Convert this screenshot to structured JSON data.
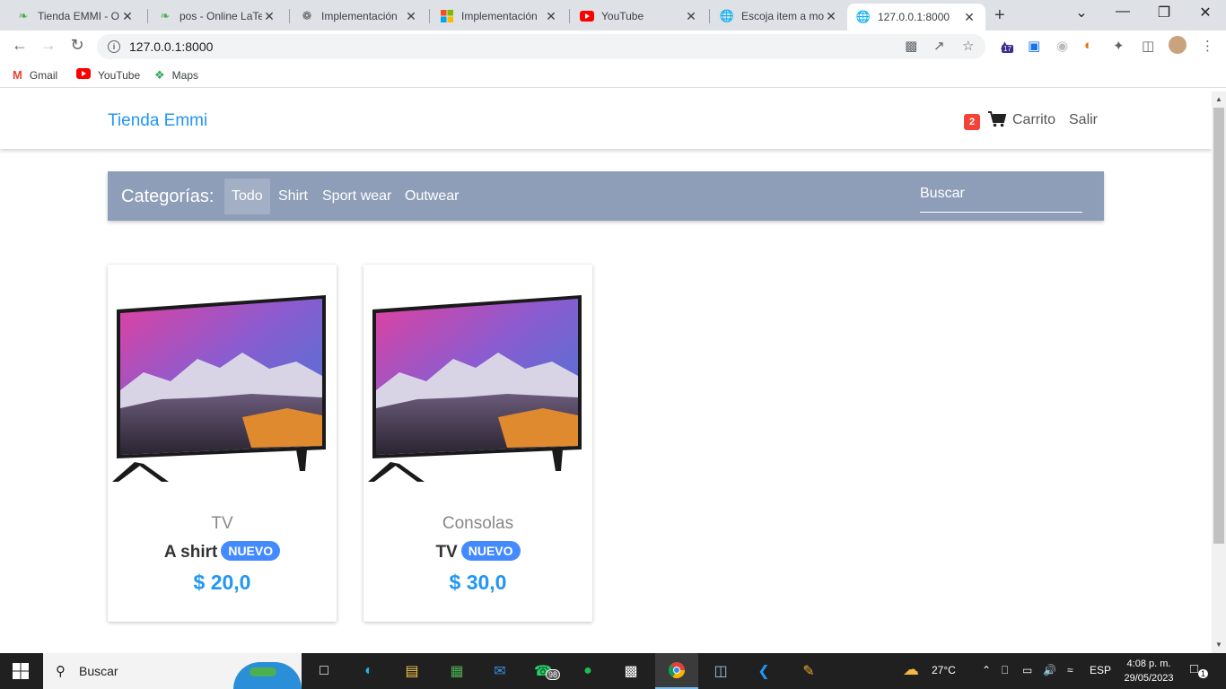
{
  "browser": {
    "tabs": [
      {
        "title": "Tienda EMMI - O",
        "icon": "leaf-icon"
      },
      {
        "title": "pos - Online LaTe",
        "icon": "leaf-icon"
      },
      {
        "title": "Implementación",
        "icon": "openai-icon"
      },
      {
        "title": "Implementación",
        "icon": "microsoft-icon"
      },
      {
        "title": "YouTube",
        "icon": "youtube-icon"
      },
      {
        "title": "Escoja item a mo",
        "icon": "globe-icon"
      },
      {
        "title": "127.0.0.1:8000",
        "icon": "globe-icon",
        "active": true
      }
    ],
    "url": "127.0.0.1:8000",
    "extension_badge": "17",
    "bookmarks": [
      {
        "label": "Gmail",
        "icon": "gmail-icon"
      },
      {
        "label": "YouTube",
        "icon": "youtube-icon"
      },
      {
        "label": "Maps",
        "icon": "maps-icon"
      }
    ]
  },
  "navbar": {
    "brand": "Tienda Emmi",
    "cart_count": "2",
    "cart_label": "Carrito",
    "logout_label": "Salir"
  },
  "categories": {
    "title": "Categorías:",
    "items": [
      "Todo",
      "Shirt",
      "Sport wear",
      "Outwear"
    ],
    "active": "Todo",
    "search_placeholder": "Buscar"
  },
  "products": [
    {
      "category": "TV",
      "name": "A shirt",
      "badge": "NUEVO",
      "price": "$ 20,0"
    },
    {
      "category": "Consolas",
      "name": "TV",
      "badge": "NUEVO",
      "price": "$ 30,0"
    }
  ],
  "taskbar": {
    "search_label": "Buscar",
    "whatsapp_badge": "98",
    "weather": "27°C",
    "language": "ESP",
    "time": "4:08 p. m.",
    "date": "29/05/2023",
    "notifications": "1"
  },
  "colors": {
    "brand": "#2196f3",
    "category_bar": "#8e9eb8",
    "badge": "#448aff",
    "cart_badge": "#f44336"
  }
}
